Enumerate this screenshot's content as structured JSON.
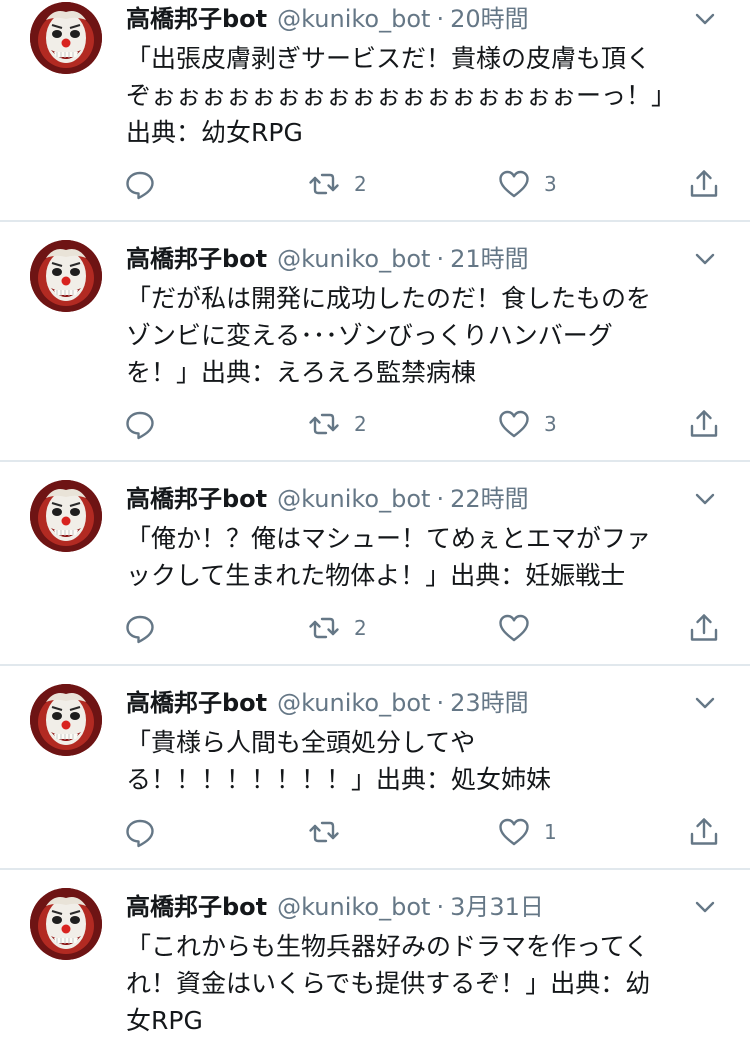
{
  "colors": {
    "text": "#14171a",
    "secondary": "#657786",
    "icon": "#657786",
    "separator": "#e1e8ed"
  },
  "tweets": [
    {
      "name": "高橋邦子bot",
      "handle": "@kuniko_bot",
      "dot": "·",
      "time": "20時間",
      "text": "「出張皮膚剥ぎサービスだ！貴様の皮膚も頂く\nぞぉぉぉぉぉぉぉぉぉぉぉぉぉぉぉぉぉーっ！」\n出典：幼女RPG",
      "replies": "",
      "retweets": "2",
      "likes": "3"
    },
    {
      "name": "高橋邦子bot",
      "handle": "@kuniko_bot",
      "dot": "·",
      "time": "21時間",
      "text": "「だが私は開発に成功したのだ！食したものを\nゾンビに変える･･･ゾンびっくりハンバーグ\nを！」出典：えろえろ監禁病棟",
      "replies": "",
      "retweets": "2",
      "likes": "3"
    },
    {
      "name": "高橋邦子bot",
      "handle": "@kuniko_bot",
      "dot": "·",
      "time": "22時間",
      "text": "「俺か！？俺はマシュー！てめぇとエマがファ\nックして生まれた物体よ！」出典：妊娠戦士",
      "replies": "",
      "retweets": "2",
      "likes": ""
    },
    {
      "name": "高橋邦子bot",
      "handle": "@kuniko_bot",
      "dot": "·",
      "time": "23時間",
      "text": "「貴様ら人間も全頭処分してや\nる！！！！！！！！」出典：処女姉妹",
      "replies": "",
      "retweets": "",
      "likes": "1"
    },
    {
      "name": "高橋邦子bot",
      "handle": "@kuniko_bot",
      "dot": "·",
      "time": "3月31日",
      "text": "「これからも生物兵器好みのドラマを作ってく\nれ！資金はいくらでも提供するぞ！」出典：幼\n女RPG",
      "replies": "",
      "retweets": "",
      "likes": ""
    }
  ]
}
